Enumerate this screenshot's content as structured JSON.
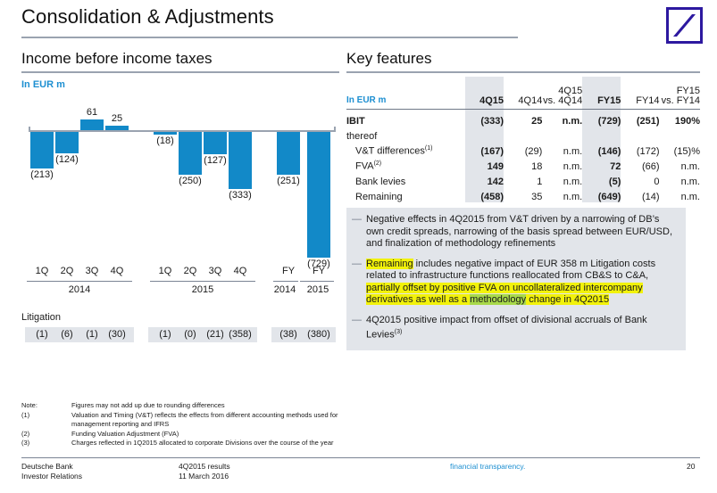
{
  "slide": {
    "title": "Consolidation & Adjustments",
    "page_number": "20"
  },
  "logo": {
    "name": "deutsche-bank-logo",
    "color": "#2d19a0"
  },
  "left": {
    "heading": "Income before income taxes",
    "unit_label": "In EUR m",
    "litigation_title": "Litigation"
  },
  "chart_data": {
    "type": "bar",
    "title": "Income before income taxes",
    "ylabel": "In EUR m",
    "xlabel": "",
    "categories": [
      "1Q",
      "2Q",
      "3Q",
      "4Q",
      "1Q",
      "2Q",
      "3Q",
      "4Q",
      "FY",
      "FY"
    ],
    "groups": [
      {
        "label": "2014",
        "span": 4
      },
      {
        "label": "2015",
        "span": 4
      },
      {
        "label": "2014",
        "span": 1
      },
      {
        "label": "2015",
        "span": 1
      }
    ],
    "values": [
      -213,
      -124,
      61,
      25,
      -18,
      -250,
      -127,
      -333,
      -251,
      -729
    ],
    "display_values": [
      "(213)",
      "(124)",
      "61",
      "25",
      "(18)",
      "(250)",
      "(127)",
      "(333)",
      "(251)",
      "(729)"
    ],
    "bar_color": "#1289c8",
    "ylim": [
      -760,
      90
    ],
    "grid": false,
    "legend": "none",
    "secondary_series": {
      "name": "Litigation",
      "display_values": [
        "(1)",
        "(6)",
        "(1)",
        "(30)",
        "(1)",
        "(0)",
        "(21)",
        "(358)",
        "(38)",
        "(380)"
      ],
      "values": [
        -1,
        -6,
        -1,
        -30,
        -1,
        0,
        -21,
        -358,
        -38,
        -380
      ]
    }
  },
  "right": {
    "heading": "Key features",
    "table": {
      "unit_label": "In EUR m",
      "columns": [
        {
          "label": "4Q15",
          "highlight": true
        },
        {
          "label": "4Q14",
          "highlight": false
        },
        {
          "label": "4Q15\nvs. 4Q14",
          "line1": "4Q15",
          "line2": "vs. 4Q14",
          "highlight": false
        },
        {
          "label": "FY15",
          "highlight": true
        },
        {
          "label": "FY14",
          "highlight": false
        },
        {
          "label": "FY15\nvs. FY14",
          "line1": "FY15",
          "line2": "vs. FY14",
          "highlight": false
        }
      ],
      "rows": [
        {
          "label": "IBIT",
          "type": "total",
          "values": [
            "(333)",
            "25",
            "n.m.",
            "(729)",
            "(251)",
            "190%"
          ]
        },
        {
          "label": "thereof",
          "type": "subheader",
          "values": [
            "",
            "",
            "",
            "",
            "",
            ""
          ]
        },
        {
          "label": "V&T differences",
          "sup": "(1)",
          "type": "item",
          "values": [
            "(167)",
            "(29)",
            "n.m.",
            "(146)",
            "(172)",
            "(15)%"
          ]
        },
        {
          "label": "FVA",
          "sup": "(2)",
          "type": "item",
          "values": [
            "149",
            "18",
            "n.m.",
            "72",
            "(66)",
            "n.m."
          ]
        },
        {
          "label": "Bank levies",
          "sup": "",
          "type": "item",
          "values": [
            "142",
            "1",
            "n.m.",
            "(5)",
            "0",
            "n.m."
          ]
        },
        {
          "label": "Remaining",
          "sup": "",
          "type": "item",
          "values": [
            "(458)",
            "35",
            "n.m.",
            "(649)",
            "(14)",
            "n.m."
          ]
        }
      ]
    },
    "bullets": [
      {
        "segments": [
          {
            "text": "Negative effects in 4Q2015 from V&T driven by a narrowing of DB’s own credit spreads, narrowing of the basis spread between EUR/USD, and finalization of methodology refinements",
            "highlight": "none"
          }
        ]
      },
      {
        "segments": [
          {
            "text": "Remaining",
            "highlight": "yellow"
          },
          {
            "text": " includes negative impact of EUR 358 m Litigation costs related to infrastructure functions reallocated from CB&S to C&A, ",
            "highlight": "none"
          },
          {
            "text": "partially offset by positive FVA on uncollateralized intercompany derivatives as well as a ",
            "highlight": "yellow"
          },
          {
            "text": "methodology",
            "highlight": "green"
          },
          {
            "text": " change in 4Q2015",
            "highlight": "yellow"
          }
        ]
      },
      {
        "segments": [
          {
            "text": "4Q2015 positive impact from offset of divisional accruals of Bank Levies",
            "highlight": "none"
          },
          {
            "text": "(3)",
            "highlight": "none",
            "sup": true
          }
        ]
      }
    ]
  },
  "footnotes": [
    {
      "key": "Note:",
      "text": "Figures may not add up due to rounding differences"
    },
    {
      "key": "(1)",
      "text": "Valuation and Timing (V&T) reflects the effects from different accounting methods used for management reporting and IFRS"
    },
    {
      "key": "(2)",
      "text": "Funding Valuation Adjustment (FVA)"
    },
    {
      "key": "(3)",
      "text": "Charges reflected in 1Q2015 allocated to corporate Divisions over the course of the year"
    }
  ],
  "footer": {
    "company": "Deutsche Bank",
    "department": "Investor Relations",
    "results": "4Q2015 results",
    "date": "11 March 2016",
    "tagline": "financial transparency.",
    "page": "20"
  },
  "colors": {
    "bar": "#1289c8",
    "panel_bg": "#e2e5ea",
    "accent_blue": "#1d8fd1",
    "logo": "#2d19a0",
    "highlight_yellow": "#f2f20a",
    "highlight_green": "#a8d94a"
  }
}
